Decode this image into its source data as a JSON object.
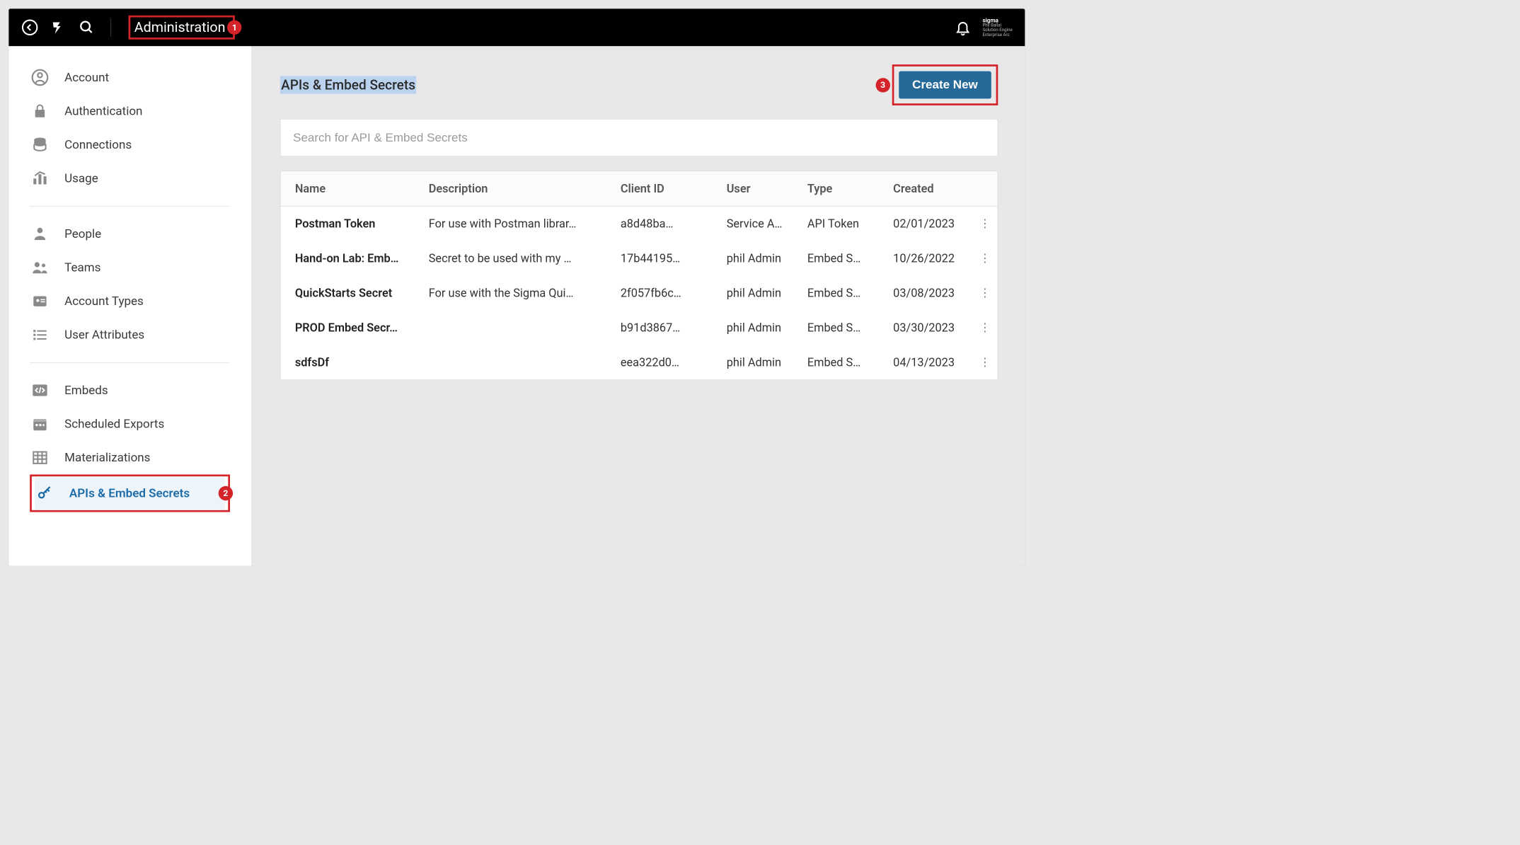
{
  "topbar": {
    "title": "Administration",
    "badge_1": "1",
    "brand_lines": [
      "sigma",
      "Phil Ballai",
      "Solution Engine",
      "Enterprise Arc"
    ]
  },
  "sidebar": {
    "group1": [
      {
        "id": "account",
        "label": "Account"
      },
      {
        "id": "authentication",
        "label": "Authentication"
      },
      {
        "id": "connections",
        "label": "Connections"
      },
      {
        "id": "usage",
        "label": "Usage"
      }
    ],
    "group2": [
      {
        "id": "people",
        "label": "People"
      },
      {
        "id": "teams",
        "label": "Teams"
      },
      {
        "id": "account-types",
        "label": "Account Types"
      },
      {
        "id": "user-attributes",
        "label": "User Attributes"
      }
    ],
    "group3": [
      {
        "id": "embeds",
        "label": "Embeds"
      },
      {
        "id": "scheduled-exports",
        "label": "Scheduled Exports"
      },
      {
        "id": "materializations",
        "label": "Materializations"
      },
      {
        "id": "apis-embed-secrets",
        "label": "APIs & Embed Secrets",
        "active": true,
        "annot": "2"
      }
    ]
  },
  "main": {
    "page_title": "APIs & Embed Secrets",
    "create_label": "Create New",
    "create_annot": "3",
    "search_placeholder": "Search for API & Embed Secrets",
    "columns": [
      "Name",
      "Description",
      "Client ID",
      "User",
      "Type",
      "Created"
    ],
    "rows": [
      {
        "name": "Postman Token",
        "description": "For use with Postman librar…",
        "client_id": "a8d48ba…",
        "user": "Service A…",
        "type": "API Token",
        "created": "02/01/2023"
      },
      {
        "name": "Hand-on Lab: Emb…",
        "description": "Secret to be used with my …",
        "client_id": "17b44195…",
        "user": "phil Admin",
        "type": "Embed S…",
        "created": "10/26/2022"
      },
      {
        "name": "QuickStarts Secret",
        "description": "For use with the Sigma Qui…",
        "client_id": "2f057fb6c…",
        "user": "phil Admin",
        "type": "Embed S…",
        "created": "03/08/2023"
      },
      {
        "name": "PROD Embed Secr…",
        "description": "",
        "client_id": "b91d3867…",
        "user": "phil Admin",
        "type": "Embed S…",
        "created": "03/30/2023"
      },
      {
        "name": "sdfsDf",
        "description": "",
        "client_id": "eea322d0…",
        "user": "phil Admin",
        "type": "Embed S…",
        "created": "04/13/2023"
      }
    ]
  }
}
